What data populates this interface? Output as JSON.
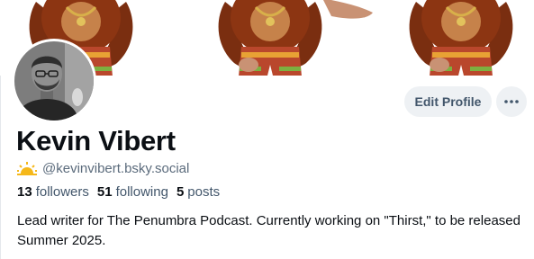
{
  "profile": {
    "display_name": "Kevin Vibert",
    "handle": "@kevinvibert.bsky.social",
    "handle_icon": "sun-emoji-icon",
    "avatar": "profile-photo-man-with-glasses-and-beard",
    "banner": "repeated-cartoon-gorilla-wearing-shorts"
  },
  "stats": {
    "followers_count": "13",
    "followers_label": "followers",
    "following_count": "51",
    "following_label": "following",
    "posts_count": "5",
    "posts_label": "posts"
  },
  "actions": {
    "edit_label": "Edit Profile",
    "more_icon": "more-horizontal-icon"
  },
  "bio": "Lead writer for The Penumbra Podcast. Currently working on \"Thirst,\" to be released Summer 2025.",
  "colors": {
    "button_bg": "#eef1f4",
    "button_text": "#42566b",
    "muted_text": "#5b6b7c",
    "primary_text": "#0b0f14"
  }
}
